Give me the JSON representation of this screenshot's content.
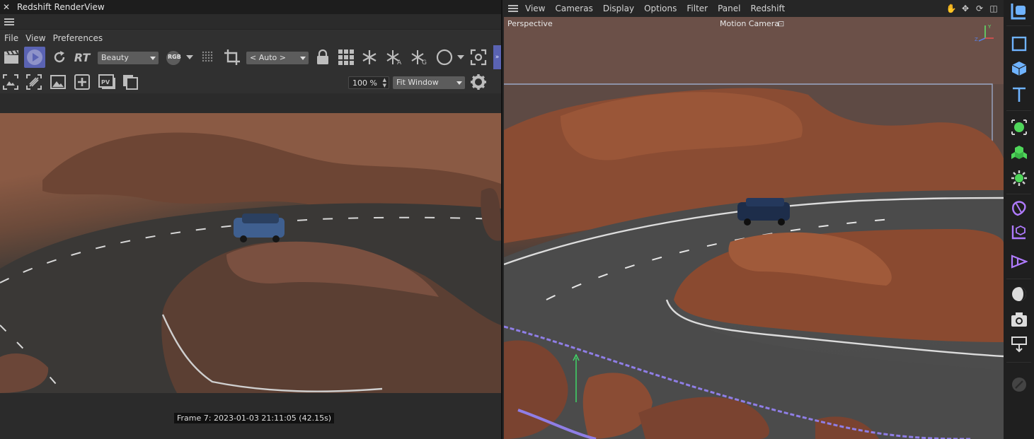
{
  "renderview": {
    "title": "Redshift RenderView",
    "menu": [
      "File",
      "View",
      "Preferences"
    ],
    "rt_label": "RT",
    "aov_select": "Beauty",
    "rgb_badge": "RGB",
    "camera_select": "< Auto >",
    "zoom_value": "100 %",
    "fit_select": "Fit Window",
    "status": "Frame  7:  2023-01-03  21:11:05  (42.15s)"
  },
  "viewport": {
    "menu": [
      "View",
      "Cameras",
      "Display",
      "Options",
      "Filter",
      "Panel",
      "Redshift"
    ],
    "projection_label": "Perspective",
    "camera_label": "Motion Camera"
  },
  "colors": {
    "accent": "#5a63b3",
    "tool_blue": "#6fb3ff",
    "tool_green": "#4fd65a",
    "tool_purple": "#b07bff"
  },
  "icons": {
    "tools": [
      "render-icon",
      "cube-outline-icon",
      "cube-icon",
      "text-icon",
      "object-green-icon",
      "cluster-icon",
      "gear-green-icon",
      "deformer-icon",
      "field-icon",
      "spline-icon",
      "light-icon",
      "camera-icon",
      "floor-icon",
      "disabled-icon"
    ]
  }
}
